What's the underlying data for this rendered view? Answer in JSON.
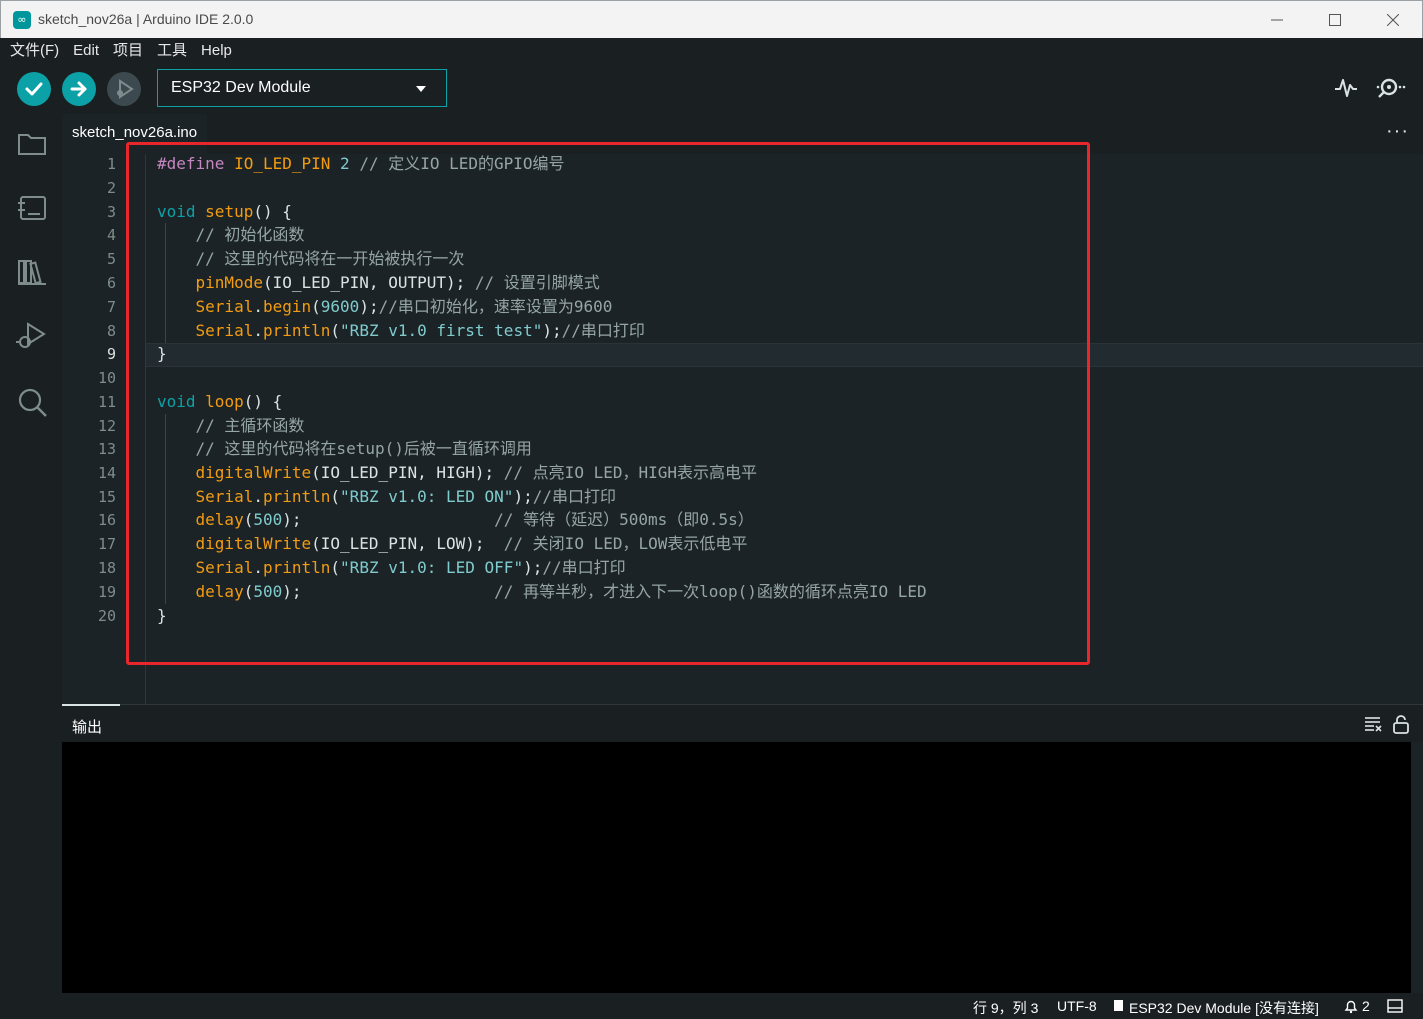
{
  "window": {
    "title": "sketch_nov26a | Arduino IDE 2.0.0",
    "app_icon": "∞"
  },
  "menu": [
    "文件(F)",
    "Edit",
    "项目",
    "工具",
    "Help"
  ],
  "toolbar": {
    "board": "ESP32 Dev Module"
  },
  "editor": {
    "tab": "sketch_nov26a.ino",
    "current_line": 9,
    "line_numbers": [
      "1",
      "2",
      "3",
      "4",
      "5",
      "6",
      "7",
      "8",
      "9",
      "10",
      "11",
      "12",
      "13",
      "14",
      "15",
      "16",
      "17",
      "18",
      "19",
      "20"
    ]
  },
  "output": {
    "title": "输出"
  },
  "status": {
    "position": "行 9，列 3",
    "encoding": "UTF-8",
    "board": "ESP32 Dev Module [没有连接]",
    "notifications": "2"
  },
  "colors": {
    "accent": "#0ca1a6",
    "highlight_box": "#e8262b"
  }
}
